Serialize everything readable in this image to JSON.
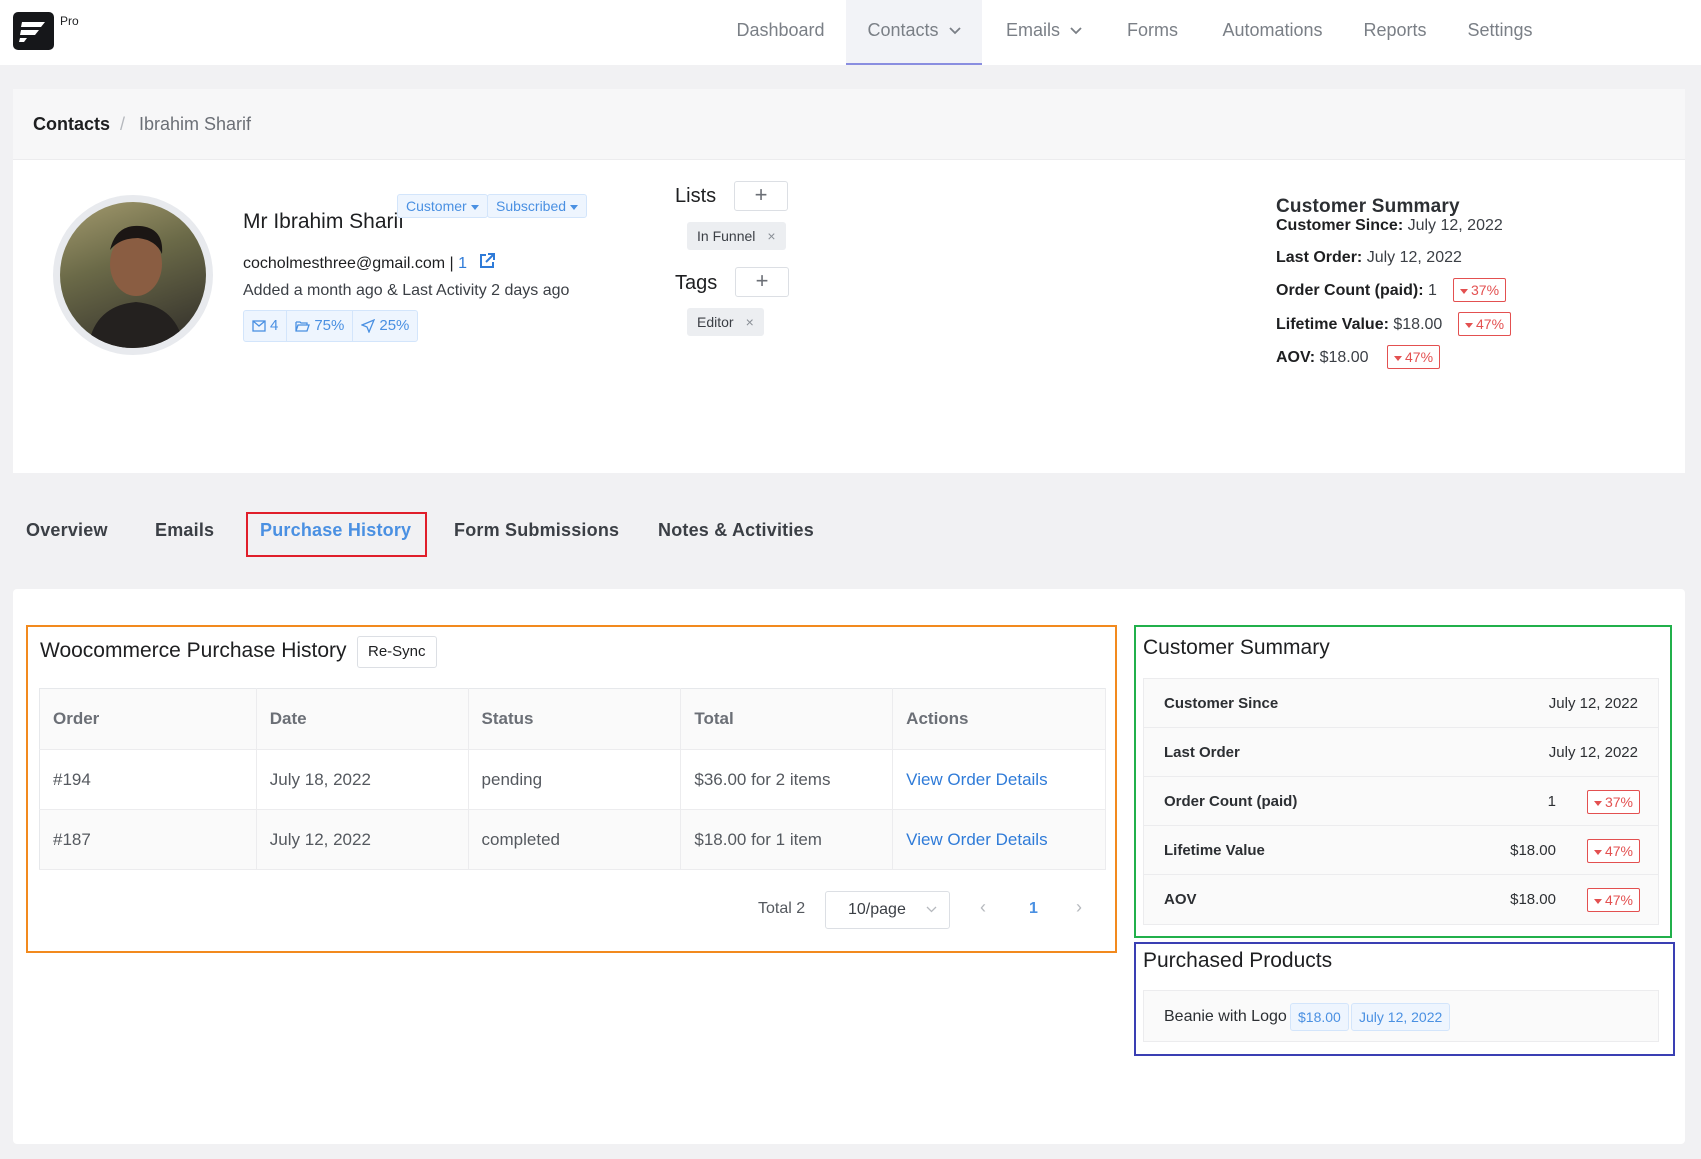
{
  "nav": {
    "pro_label": "Pro",
    "items": [
      "Dashboard",
      "Contacts",
      "Emails",
      "Forms",
      "Automations",
      "Reports",
      "Settings"
    ]
  },
  "breadcrumb": {
    "root": "Contacts",
    "separator": "/",
    "current": "Ibrahim Sharif"
  },
  "contact": {
    "name": "Mr Ibrahim Sharif",
    "type_badge": "Customer",
    "status_badge": "Subscribed",
    "email": "cocholmesthree@gmail.com",
    "email_sep": "|",
    "email_count": "1",
    "activity": "Added a month ago & Last Activity 2 days ago",
    "stats": {
      "emails": "4",
      "open_rate": "75%",
      "click_rate": "25%"
    }
  },
  "lists": {
    "label": "Lists",
    "plus": "+",
    "items": [
      "In Funnel"
    ],
    "remove": "×"
  },
  "tags": {
    "label": "Tags",
    "plus": "+",
    "items": [
      "Editor"
    ],
    "remove": "×"
  },
  "header_summary": {
    "title": "Customer Summary",
    "customer_since_label": "Customer Since:",
    "customer_since": "July 12, 2022",
    "last_order_label": "Last Order:",
    "last_order": "July 12, 2022",
    "order_count_label": "Order Count (paid):",
    "order_count": "1",
    "order_count_change": "37%",
    "lifetime_label": "Lifetime Value:",
    "lifetime_value": "$18.00",
    "lifetime_change": "47%",
    "aov_label": "AOV:",
    "aov": "$18.00",
    "aov_change": "47%"
  },
  "tabs": [
    "Overview",
    "Emails",
    "Purchase History",
    "Form Submissions",
    "Notes & Activities"
  ],
  "purchase_history": {
    "title": "Woocommerce Purchase History",
    "resync_label": "Re-Sync",
    "columns": [
      "Order",
      "Date",
      "Status",
      "Total",
      "Actions"
    ],
    "rows": [
      [
        "#194",
        "July 18, 2022",
        "pending",
        "$36.00 for 2 items",
        "View Order Details"
      ],
      [
        "#187",
        "July 12, 2022",
        "completed",
        "$18.00 for 1 item",
        "View Order Details"
      ]
    ],
    "pagination": {
      "total": "Total 2",
      "page_size": "10/page",
      "current_page": "1",
      "prev": "‹",
      "next": "›"
    }
  },
  "customer_summary": {
    "title": "Customer Summary",
    "rows": [
      {
        "label": "Customer Since",
        "value": "July 12, 2022"
      },
      {
        "label": "Last Order",
        "value": "July 12, 2022"
      },
      {
        "label": "Order Count (paid)",
        "value": "1",
        "change": "37%"
      },
      {
        "label": "Lifetime Value",
        "value": "$18.00",
        "change": "47%"
      },
      {
        "label": "AOV",
        "value": "$18.00",
        "change": "47%"
      }
    ]
  },
  "purchased_products": {
    "title": "Purchased Products",
    "items": [
      {
        "name": "Beanie with Logo",
        "price": "$18.00",
        "date": "July 12, 2022"
      }
    ]
  },
  "colors": {
    "accent": "#4a90e2",
    "negative": "#e35050",
    "highlight_red": "#e01e2a",
    "highlight_orange": "#f28a1e",
    "highlight_green": "#21b04b",
    "highlight_blue": "#3a3fb3"
  }
}
